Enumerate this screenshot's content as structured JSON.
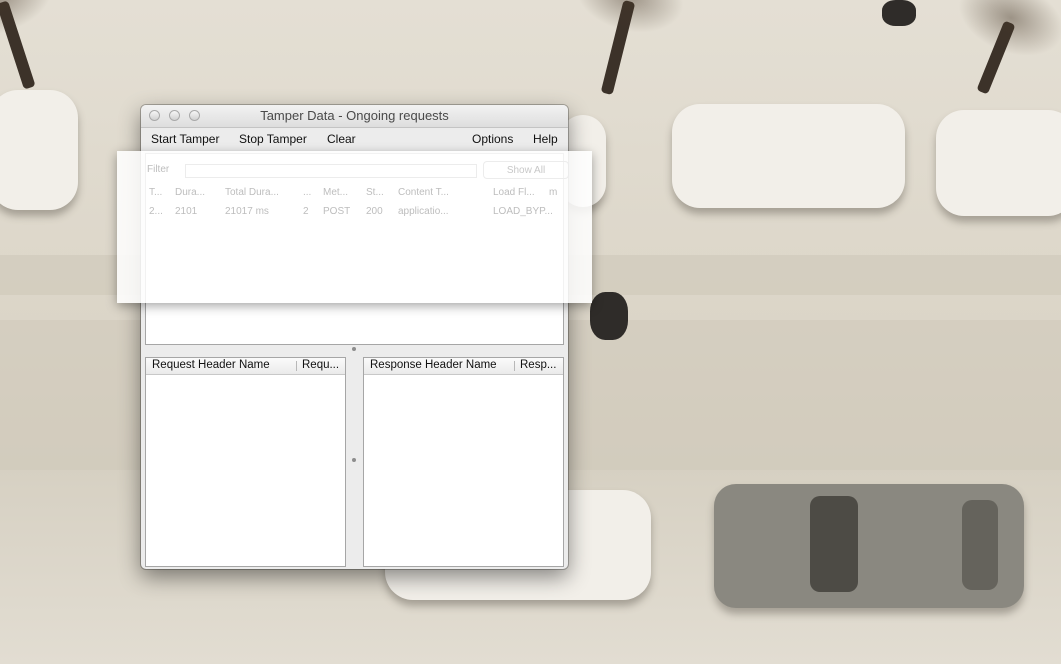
{
  "window": {
    "title": "Tamper Data - Ongoing requests"
  },
  "menubar": {
    "start_tamper": "Start Tamper",
    "stop_tamper": "Stop Tamper",
    "clear": "Clear",
    "options": "Options",
    "help": "Help"
  },
  "overlay": {
    "filter_label": "Filter",
    "show_all": "Show All",
    "columns": [
      "T...",
      "Dura...",
      "Total Dura...",
      "...",
      "Met...",
      "St...",
      "Content T...",
      "Load Fl...",
      "m"
    ],
    "row": [
      "2...",
      "2101",
      "21017 ms",
      "2",
      "POST",
      "200",
      "applicatio...",
      "LOAD_BYP..."
    ]
  },
  "request_headers": {
    "col_name": "Request Header Name",
    "col_value": "Requ..."
  },
  "response_headers": {
    "col_name": "Response Header Name",
    "col_value": "Resp..."
  }
}
